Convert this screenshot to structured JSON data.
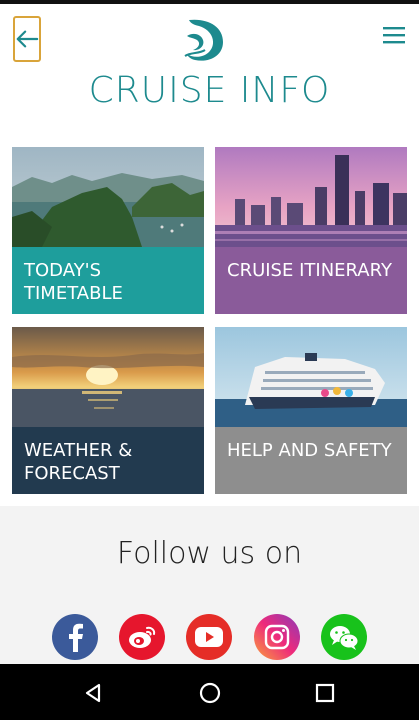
{
  "header": {
    "title": "CRUISE INFO",
    "back_icon": "arrow-left-icon",
    "menu_icon": "hamburger-icon",
    "logo_icon": "dream-cruises-logo",
    "accent_color": "#1d8a8e",
    "back_border_color": "#d9a43a"
  },
  "tiles": [
    {
      "label": "TODAY'S TIMETABLE",
      "color": "#1e9e9c",
      "image": "bay-islands-photo"
    },
    {
      "label": "CRUISE ITINERARY",
      "color": "#8a5b9a",
      "image": "city-skyline-photo"
    },
    {
      "label": "WEATHER & FORECAST",
      "color": "#223a4f",
      "image": "sunset-sea-photo"
    },
    {
      "label": "HELP AND SAFETY",
      "color": "#8e8e8e",
      "image": "cruise-ship-photo"
    }
  ],
  "follow": {
    "title": "Follow us on",
    "networks": [
      {
        "icon": "facebook-icon",
        "color": "#3b5a9a"
      },
      {
        "icon": "weibo-icon",
        "color": "#e6162d"
      },
      {
        "icon": "youtube-icon",
        "color": "#e52d27"
      },
      {
        "icon": "instagram-icon",
        "color": "#ee2a7b"
      },
      {
        "icon": "wechat-icon",
        "color": "#18c21b"
      }
    ]
  },
  "system_nav": {
    "back_icon": "triangle-back-icon",
    "home_icon": "circle-home-icon",
    "recents_icon": "square-recents-icon"
  }
}
